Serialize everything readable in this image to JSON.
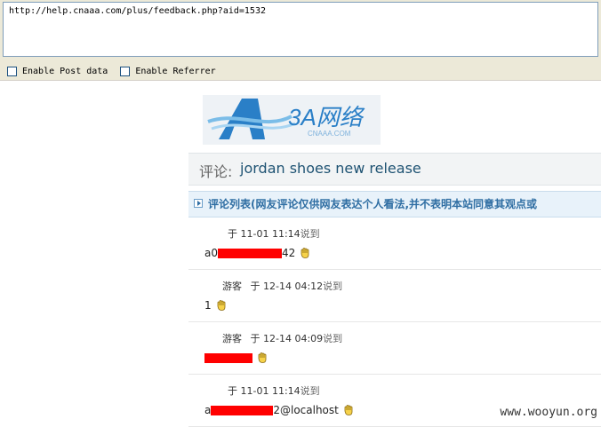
{
  "toolbar": {
    "url": "http://help.cnaaa.com/plus/feedback.php?aid=1532",
    "enable_post_label": "Enable Post data",
    "enable_referrer_label": "Enable Referrer"
  },
  "page": {
    "logo_text": "3A网络",
    "logo_sub": "CNAAA.COM",
    "title_prefix": "评论:",
    "title": "jordan shoes new release",
    "list_header": "评论列表(网友评论仅供网友表达个人看法,并不表明本站同意其观点或"
  },
  "comments": [
    {
      "user": "",
      "time": "于 11-01 11:14",
      "said": "说到",
      "content_start": "a0",
      "content_end": "42"
    },
    {
      "user": "游客",
      "time": "于 12-14 04:12",
      "said": "说到",
      "content_start": "1",
      "content_end": ""
    },
    {
      "user": "游客",
      "time": "于 12-14 04:09",
      "said": "说到",
      "content_start": "",
      "content_end": ""
    },
    {
      "user": "",
      "time": "于 11-01 11:14",
      "said": "说到",
      "content_start": "a",
      "content_end": "2@localhost"
    }
  ],
  "watermark": "www.wooyun.org"
}
